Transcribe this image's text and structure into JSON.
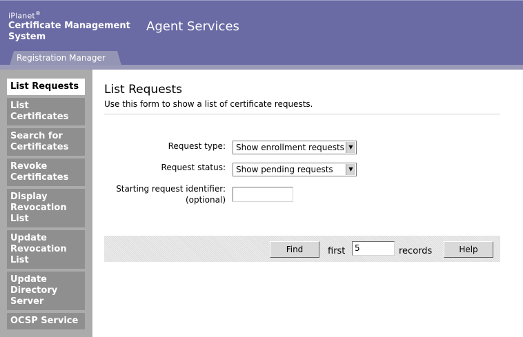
{
  "header": {
    "brand_top": "iPlanet",
    "brand_mark": "®",
    "brand_line1": "Certificate Management",
    "brand_line2": "System",
    "app_title": "Agent Services",
    "tab_label": "Registration Manager"
  },
  "sidebar": {
    "items": [
      {
        "lines": [
          "List Requests"
        ]
      },
      {
        "lines": [
          "List",
          "Certificates"
        ]
      },
      {
        "lines": [
          "Search for",
          "Certificates"
        ]
      },
      {
        "lines": [
          "Revoke",
          "Certificates"
        ]
      },
      {
        "lines": [
          "Display",
          "Revocation",
          "List"
        ]
      },
      {
        "lines": [
          "Update",
          "Revocation",
          "List"
        ]
      },
      {
        "lines": [
          "Update",
          "Directory",
          "Server"
        ]
      },
      {
        "lines": [
          "OCSP Service"
        ]
      }
    ]
  },
  "main": {
    "title": "List Requests",
    "description": "Use this form to show a list of certificate requests.",
    "form": {
      "request_type_label": "Request type:",
      "request_type_value": "Show enrollment requests",
      "request_status_label": "Request status:",
      "request_status_value": "Show pending requests",
      "starting_id_label_line1": "Starting request identifier:",
      "starting_id_label_line2": "(optional)",
      "starting_id_value": ""
    },
    "actions": {
      "find_label": "Find",
      "first_label": "first",
      "records_value": "5",
      "records_label": "records",
      "help_label": "Help"
    }
  },
  "colors": {
    "header_bg": "#6a6aa4",
    "tab_bg": "#9494b4",
    "sidebar_bg": "#ababab",
    "nav_item_bg": "#8f8f8f",
    "nav_active_bg": "#ffffff"
  },
  "icons": {
    "dropdown_arrow": "chevron-down-icon"
  }
}
